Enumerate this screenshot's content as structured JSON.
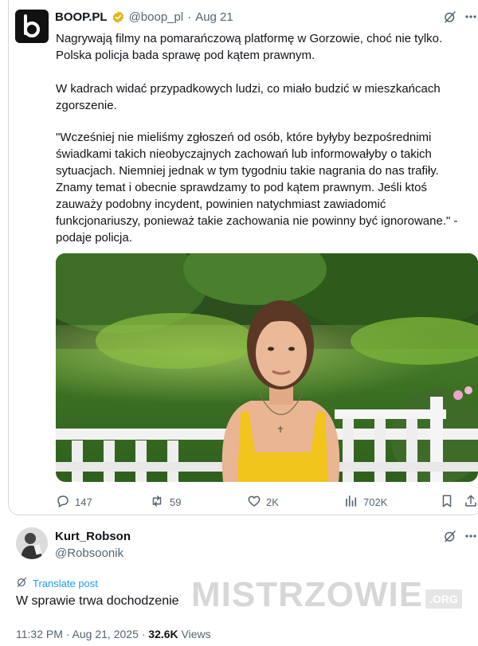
{
  "quoted_post": {
    "author_name": "BOOP.PL",
    "handle": "@boop_pl",
    "separator": "·",
    "date": "Aug 21",
    "paragraph_1": "Nagrywają filmy na pomarańczową platformę w Gorzowie, choć nie tylko. Polska policja bada sprawę pod kątem prawnym.",
    "paragraph_2": "W kadrach widać przypadkowych ludzi, co miało budzić w mieszkańcach zgorszenie.",
    "paragraph_3": "\"Wcześniej nie mieliśmy zgłoszeń od osób, które byłyby bezpośrednimi świadkami takich nieobyczajnych zachowań lub informowałyby o takich sytuacjach. Niemniej jednak w tym tygodniu takie nagrania do nas trafiły. Znamy temat i obecnie sprawdzamy to pod kątem prawnym. Jeśli ktoś zauważy podobny incydent, powinien natychmiast zawiadomić funkcjonariuszy, ponieważ takie zachowania nie powinny być ignorowane.\" - podaje policja.",
    "stats": {
      "replies": "147",
      "reposts": "59",
      "likes": "2K",
      "views": "702K"
    }
  },
  "reply": {
    "author_name": "Kurt_Robson",
    "handle": "@Robsoonik",
    "translate_label": "Translate post",
    "text": "W sprawie trwa dochodzenie",
    "time": "11:32 PM · Aug 21, 2025 · ",
    "views_count": "32.6K",
    "views_label": " Views"
  },
  "watermark": {
    "main": "MISTRZOWIE",
    "suffix": ".ORG"
  },
  "icons": [
    "boop-logo-icon",
    "verified-badge-icon",
    "grok-icon",
    "more-icon",
    "reply-icon",
    "repost-icon",
    "like-icon",
    "views-icon",
    "bookmark-icon",
    "share-icon",
    "translate-icon"
  ],
  "colors": {
    "link": "#1d9bf0",
    "muted": "#536471",
    "verified_gold": "#e2b719",
    "text": "#0f1419"
  }
}
